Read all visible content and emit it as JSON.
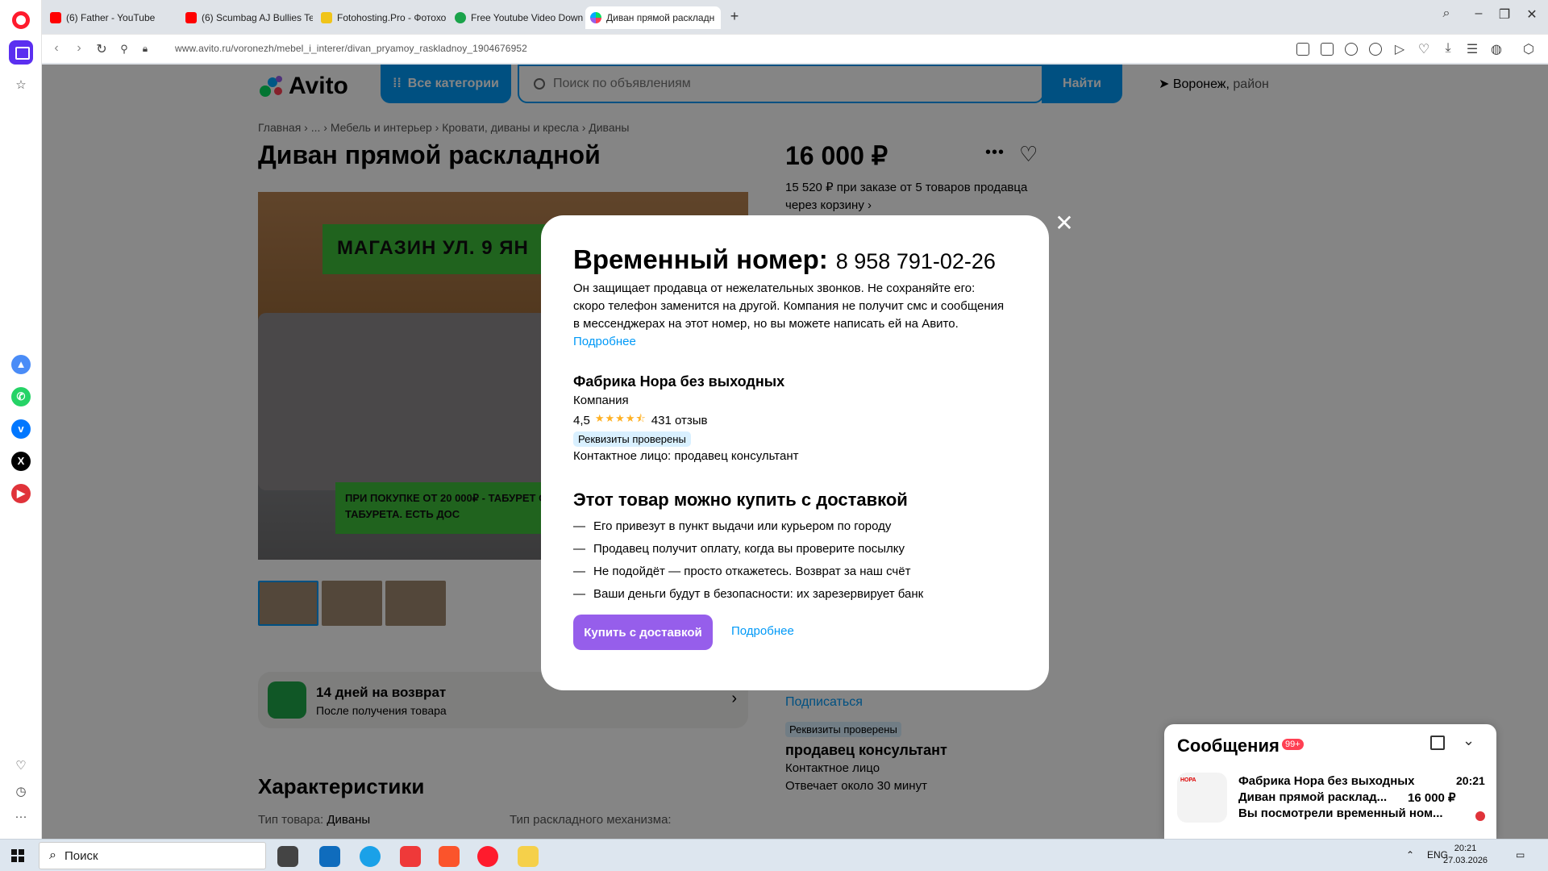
{
  "browser": {
    "tabs": [
      {
        "title": "(6) Father - YouTube",
        "favicon": "youtube-icon"
      },
      {
        "title": "(6) Scumbag AJ Bullies Te",
        "favicon": "youtube-icon"
      },
      {
        "title": "Fotohosting.Pro - Фотохо",
        "favicon": "fotohosting-icon"
      },
      {
        "title": "Free Youtube Video Down",
        "favicon": "downloader-icon"
      },
      {
        "title": "Диван прямой раскладн",
        "favicon": "avito-icon"
      }
    ],
    "url": "www.avito.ru/voronezh/mebel_i_interer/divan_pryamoy_raskladnoy_1904676952"
  },
  "header": {
    "logo": "Avito",
    "categories_label": "Все категории",
    "search_placeholder": "Поиск по объявлениям",
    "search_button": "Найти",
    "location": "Воронеж,",
    "location_region": "район"
  },
  "listing": {
    "breadcrumbs": "Главная  ›  ...  ›  Мебель и интерьер  ›  Кровати, диваны и кресла  ›  Диваны",
    "title": "Диван прямой раскладной",
    "price": "16 000 ₽",
    "bulk_offer": "15 520 ₽ при заказе от 5 товаров продавца через корзину ›",
    "photo_banner": "МАГАЗИН    УЛ. 9 ЯН",
    "photo_promo": "ПРИ ПОКУПКЕ ОТ 20 000₽ - ТАБУРЕТ ОТ 30 000₽ - 2 ТАБУРЕТА.   ЕСТЬ ДОС",
    "return_title": "14 дней на возврат",
    "return_sub": "После получения товара",
    "characteristics_title": "Характеристики",
    "char_type_label": "Тип товара:",
    "char_type_value": "Диваны",
    "char_mechanism_label": "Тип раскладного механизма:",
    "subscribe": "Подписаться",
    "verified": "Реквизиты проверены",
    "seller_contact_name": "продавец консультант",
    "contact_person": "Контактное лицо",
    "response_time": "Отвечает около 30 минут"
  },
  "modal": {
    "title": "Временный номер:",
    "phone": "8 958 791-02-26",
    "description": "Он защищает продавца от нежелательных звонков. Не сохраняйте его: скоро телефон заменится на другой. Компания не получит смс и сообщения в мессенджерах на этот номер, но вы можете написать ей на Авито.",
    "description_link": "Подробнее",
    "seller_name": "Фабрика Нора без выходных",
    "seller_type": "Компания",
    "rating": "4,5",
    "reviews": "431 отзыв",
    "verified_badge": "Реквизиты проверены",
    "contact_person": "Контактное лицо: продавец консультант",
    "delivery_title": "Этот товар можно купить с доставкой",
    "delivery_points": [
      "Его привезут в пункт выдачи или курьером по городу",
      "Продавец получит оплату, когда вы проверите посылку",
      "Не подойдёт — просто откажетесь. Возврат за наш счёт",
      "Ваши деньги будут в безопасности: их зарезервирует банк"
    ],
    "buy_button": "Купить с доставкой",
    "more_link": "Подробнее",
    "dash": "—"
  },
  "messages": {
    "title": "Сообщения",
    "count": "99+",
    "avatar_text": "НОРА",
    "chat_name": "Фабрика Нора без выходных",
    "chat_time": "20:21",
    "chat_item": "Диван прямой расклад...",
    "chat_price": "16 000 ₽",
    "chat_text": "Вы посмотрели временный ном..."
  },
  "taskbar": {
    "search_label": "Поиск",
    "language": "ENG",
    "time": "20:21",
    "date": "27.03.2026"
  },
  "colors": {
    "avito_blue": "#0099f7",
    "avito_purple": "#965eeb",
    "verified_bg": "#d9f0ff"
  }
}
